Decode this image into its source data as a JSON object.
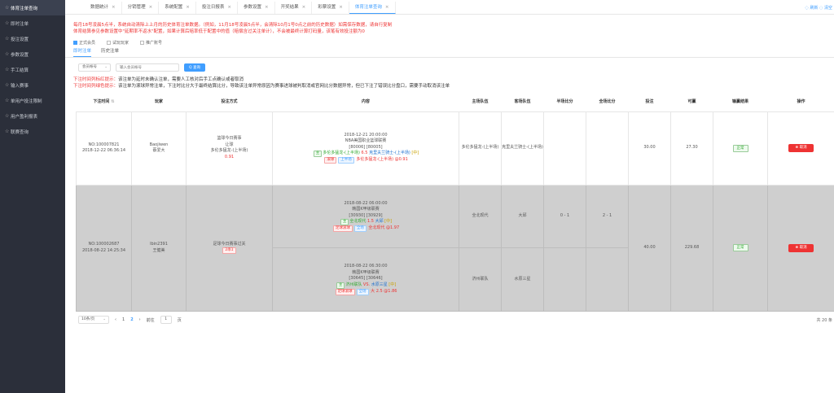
{
  "sidebar": {
    "items": [
      {
        "label": "体育注单查询",
        "active": true
      },
      {
        "label": "即时注单"
      },
      {
        "label": "投注设置"
      },
      {
        "label": "参数设置"
      },
      {
        "label": "手工结算"
      },
      {
        "label": "输入赛事"
      },
      {
        "label": "单用户投注限制"
      },
      {
        "label": "用户盈利报表"
      },
      {
        "label": "联赛查询"
      }
    ]
  },
  "tabs": [
    {
      "label": "数据统计"
    },
    {
      "label": "分销管理"
    },
    {
      "label": "系统配置"
    },
    {
      "label": "投注日报表"
    },
    {
      "label": "参数设置"
    },
    {
      "label": "开奖结果"
    },
    {
      "label": "彩票设置"
    },
    {
      "label": "体育注单查询",
      "active": true
    }
  ],
  "tab_actions": "◌ 刷新  ◌ 清空",
  "notice": {
    "line1": "每月18号凌晨5点半，系统自动清除上上月的历史体育注单数据。（例如，11月18号凌晨5点半，会清除10月1号0点之前的历史数据）如需保存数据，请自行复制",
    "line2": "体育结算参见参数设置中\"延期率不返水\"配置，如果计算后赔率低于配置中的值（赔偿含过关注单计），不会被最终计算打码量，该笔有效投注额为0"
  },
  "checks": [
    {
      "label": "正式会员",
      "checked": true
    },
    {
      "label": "试玩玩家",
      "checked": false
    },
    {
      "label": "推广账号",
      "checked": false
    }
  ],
  "subtabs": [
    {
      "label": "即时注单",
      "active": true
    },
    {
      "label": "历史注单"
    }
  ],
  "search": {
    "select_value": "会员帐号",
    "placeholder": "输入会员帐号",
    "button_label": "Q 查询"
  },
  "tips": [
    {
      "lead": "下注时间列标红提示：",
      "text": "该注单为延时未确认注单，需要人工核对后手工点确认或者取消"
    },
    {
      "lead": "下注时间列绿色提示：",
      "text": "该注单为滚球异常注单，下注时比分大于最终结算比分，导致该注单异常原因为赛事进球被判取消或官网比分数据异常，但已下注了错误比分盘口，需要手动取消该注单"
    }
  ],
  "table": {
    "headers": [
      "下注时间",
      "玩家",
      "投注方式",
      "内容",
      "主场队伍",
      "客场队伍",
      "半场比分",
      "全场比分",
      "投注",
      "可赢",
      "输赢结果",
      "操作"
    ],
    "rows": [
      {
        "order": "NO:100007821",
        "time": "2018-12-22 06:36:14",
        "player_id": "Baojiwen",
        "player_name": "蔡爱大",
        "method": [
          "篮球今日赛事",
          "让球",
          "多伦多猛龙-(上半场)"
        ],
        "method_odds": "0.91",
        "matches": [
          {
            "date": "2018-12-21 20:00:00",
            "league": "NBA美国职业篮球联赛",
            "code": "[80006]  [80005]",
            "line_tag": "主",
            "home": "多伦多猛龙-(上半场)",
            "line": "6.5",
            "away": "克里夫兰骑士-(上半场)",
            "half": "[中]",
            "bet_tag1": "滚球",
            "bet_tag2": "上半场",
            "bet_team": "多伦多猛龙-(上半场)",
            "odds": "@0.91",
            "home_col": "多伦多猛龙-(上半场)",
            "away_col": "克里夫兰骑士-(上半场)",
            "half_score": "",
            "full_score": ""
          }
        ],
        "bet": "30.00",
        "win": "27.30",
        "result": "正常",
        "action": "⊗ 取消",
        "gray": false
      },
      {
        "order": "NO:100002687",
        "time": "2018-08-22 14:25:34",
        "player_id": "lbin2391",
        "player_name": "王健美",
        "method": [
          "足球今日赛事过关"
        ],
        "method_tag": "2串1",
        "matches": [
          {
            "date": "2018-08-22 06:00:00",
            "league": "韩国K甲级联赛",
            "code": "[30930]  [30929]",
            "line_tag": "主",
            "home": "全北现代",
            "line": "1.5",
            "away": "大邱",
            "half": "[中]",
            "bet_tag1": "足球滚球",
            "bet_tag2": "全场",
            "bet_team": "全北现代",
            "odds": "@1.97",
            "home_col": "全北现代",
            "away_col": "大邱",
            "half_score": "0 - 1",
            "full_score": "2 - 1"
          },
          {
            "date": "2018-08-22 06:30:00",
            "league": "韩国K甲级联赛",
            "code": "[30645]  [30646]",
            "line_tag": "主",
            "home": "济州联队",
            "vs": "VS.",
            "away": "水原三星",
            "half": "[中]",
            "bet_tag1": "足球滚球",
            "bet_tag2": "全场",
            "bet_team": "大 2.5",
            "odds": "@1.86",
            "home_col": "济州联队",
            "away_col": "水原三星",
            "half_score": "",
            "full_score": ""
          }
        ],
        "bet": "40.00",
        "win": "229.68",
        "result": "正常",
        "action": "⊗ 取消",
        "gray": true
      }
    ]
  },
  "pager": {
    "page_size": "10条/页",
    "prev": "‹",
    "pages": [
      "1",
      "2"
    ],
    "current": "2",
    "next": "›",
    "goto_label": "前往",
    "goto_value": "1",
    "page_suffix": "页",
    "total": "共 20 条"
  },
  "colors": {
    "accent": "#409eff",
    "danger": "#ee3333",
    "sidebar": "#2b2f3a"
  }
}
